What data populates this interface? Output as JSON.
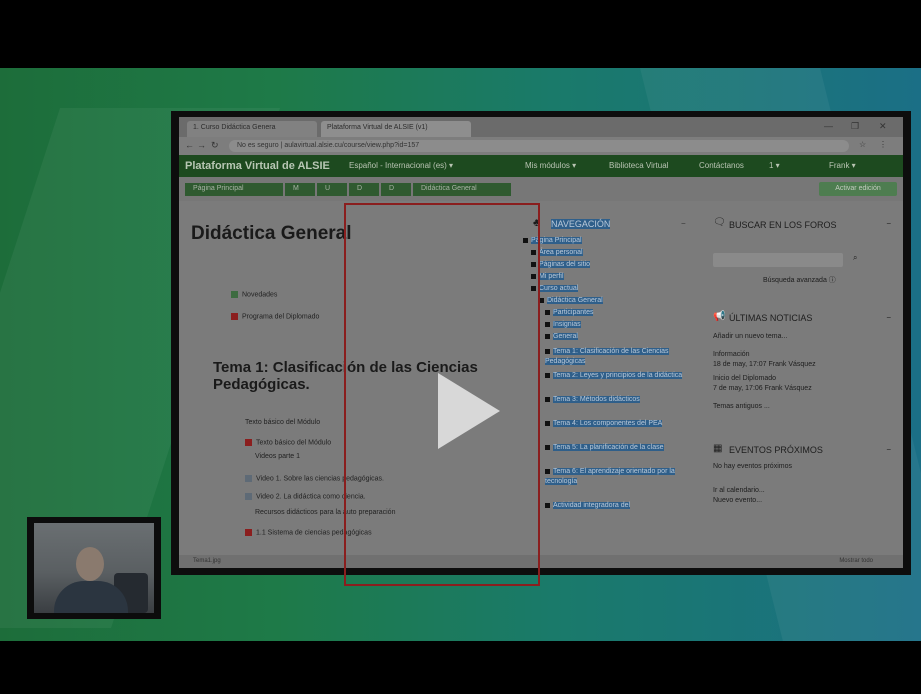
{
  "browser": {
    "tabs": [
      "1. Curso Didáctica Genera",
      "Plataforma Virtual de ALSIE (v1)"
    ],
    "window_controls": [
      "—",
      "❐",
      "✕"
    ],
    "address": "No es seguro | aulavirtual.alsie.cu/course/view.php?id=157",
    "status_left": "Tema1.jpg",
    "status_right": "Mostrar todo"
  },
  "navbar": {
    "brand": "Plataforma Virtual de ALSIE",
    "items": [
      "Español - Internacional (es) ▾",
      "Mis módulos ▾",
      "Biblioteca Virtual",
      "Contáctanos",
      "1 ▾",
      "Frank ▾"
    ]
  },
  "breadcrumb": [
    "Página Principal",
    "M",
    "U",
    "D",
    "D",
    "Didáctica General"
  ],
  "activate_edit": "Activar edición",
  "main": {
    "title": "Didáctica General",
    "items": [
      {
        "icon": "grn",
        "text": "Novedades"
      },
      {
        "icon": "red",
        "text": "Programa del Diplomado"
      }
    ],
    "topic_title": "Tema 1: Clasificación de las Ciencias Pedagógicas.",
    "topic_items": [
      {
        "icon": "",
        "text": "Texto básico del Módulo"
      },
      {
        "icon": "red",
        "text": "Texto básico del Módulo"
      },
      {
        "icon": "",
        "text": "Videos parte 1"
      },
      {
        "icon": "doc",
        "text": "Video 1. Sobre las ciencias pedagógicas."
      },
      {
        "icon": "doc",
        "text": "Video 2. La didáctica como ciencia."
      },
      {
        "icon": "",
        "text": "Recursos didácticos para la auto preparación"
      },
      {
        "icon": "red",
        "text": "1.1 Sistema de ciencias pedagógicas"
      }
    ]
  },
  "navigation": {
    "title": "NAVEGACIÓN",
    "tree": [
      {
        "level": 0,
        "text": "Página Principal"
      },
      {
        "level": 1,
        "text": "Área personal"
      },
      {
        "level": 1,
        "text": "Páginas del sitio"
      },
      {
        "level": 1,
        "text": "Mi perfil"
      },
      {
        "level": 1,
        "text": "Curso actual"
      },
      {
        "level": 2,
        "text": "Didáctica General"
      },
      {
        "level": 3,
        "text": "Participantes"
      },
      {
        "level": 3,
        "text": "Insignias"
      },
      {
        "level": 3,
        "text": "General"
      },
      {
        "level": 3,
        "text": "Tema 1: Clasificación de las Ciencias Pedagógicas"
      },
      {
        "level": 3,
        "text": "Tema 2: Leyes y principios de la didáctica"
      },
      {
        "level": 3,
        "text": "Tema 3: Métodos didácticos"
      },
      {
        "level": 3,
        "text": "Tema 4: Los componentes del PEA"
      },
      {
        "level": 3,
        "text": "Tema 5: La planificación de la clase"
      },
      {
        "level": 3,
        "text": "Tema 6: El aprendizaje orientado por la tecnología"
      },
      {
        "level": 3,
        "text": "Actividad integradora del"
      }
    ]
  },
  "sidebar": {
    "search_title": "BUSCAR EN LOS FOROS",
    "search_advanced": "Búsqueda avanzada ⓘ",
    "news_title": "ÚLTIMAS NOTICIAS",
    "news_lines": [
      "Añadir un nuevo tema...",
      "Información",
      "18 de may, 17:07 Frank Vásquez",
      "Inicio del Diplomado",
      "7 de may, 17:06 Frank Vásquez",
      "Temas antiguos ..."
    ],
    "events_title": "EVENTOS PRÓXIMOS",
    "events_lines": [
      "No hay eventos próximos",
      "Ir al calendario...",
      "Nuevo evento..."
    ]
  }
}
